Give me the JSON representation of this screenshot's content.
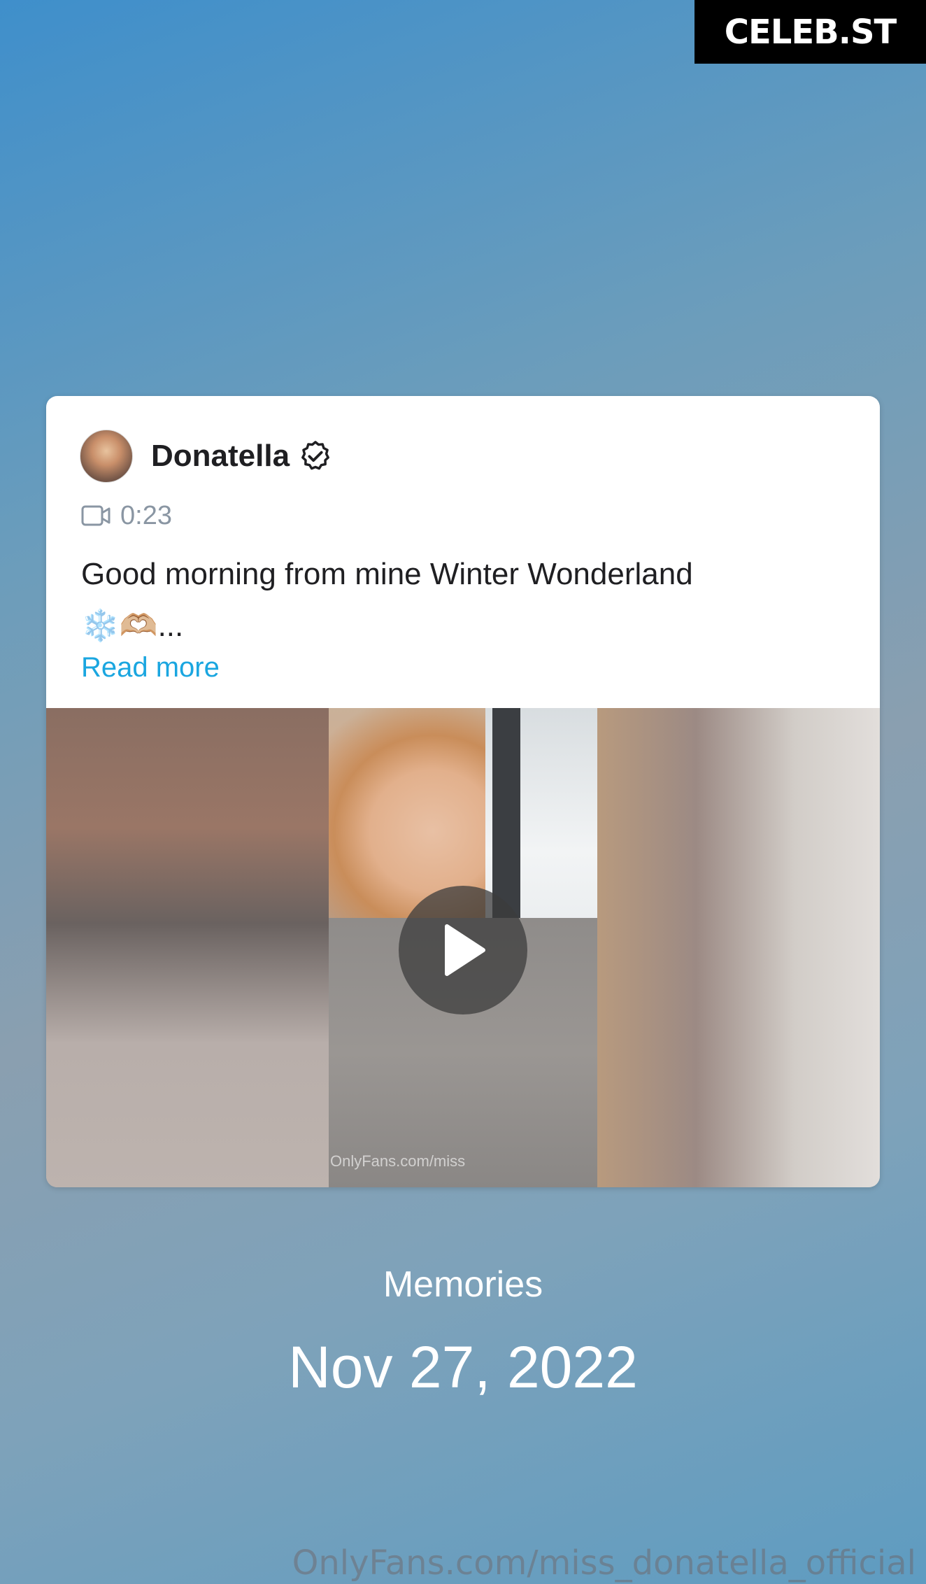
{
  "badge": {
    "text": "CELEB.ST"
  },
  "post": {
    "author": "Donatella",
    "verified_icon": "verified-badge-icon",
    "duration_icon": "video-camera-icon",
    "duration": "0:23",
    "text_line1": "Good morning from mine Winter Wonderland",
    "text_line2": "❄️🫶🏼...",
    "read_more": "Read more",
    "media_caption": "OnlyFans.com/miss",
    "play_icon": "play-icon"
  },
  "memories": {
    "label": "Memories",
    "date": "Nov 27, 2022"
  },
  "footer": {
    "watermark": "OnlyFans.com/miss_donatella_official"
  },
  "colors": {
    "link": "#1aa6e0",
    "duration_text": "#8a96a3",
    "badge_bg": "#000000"
  }
}
